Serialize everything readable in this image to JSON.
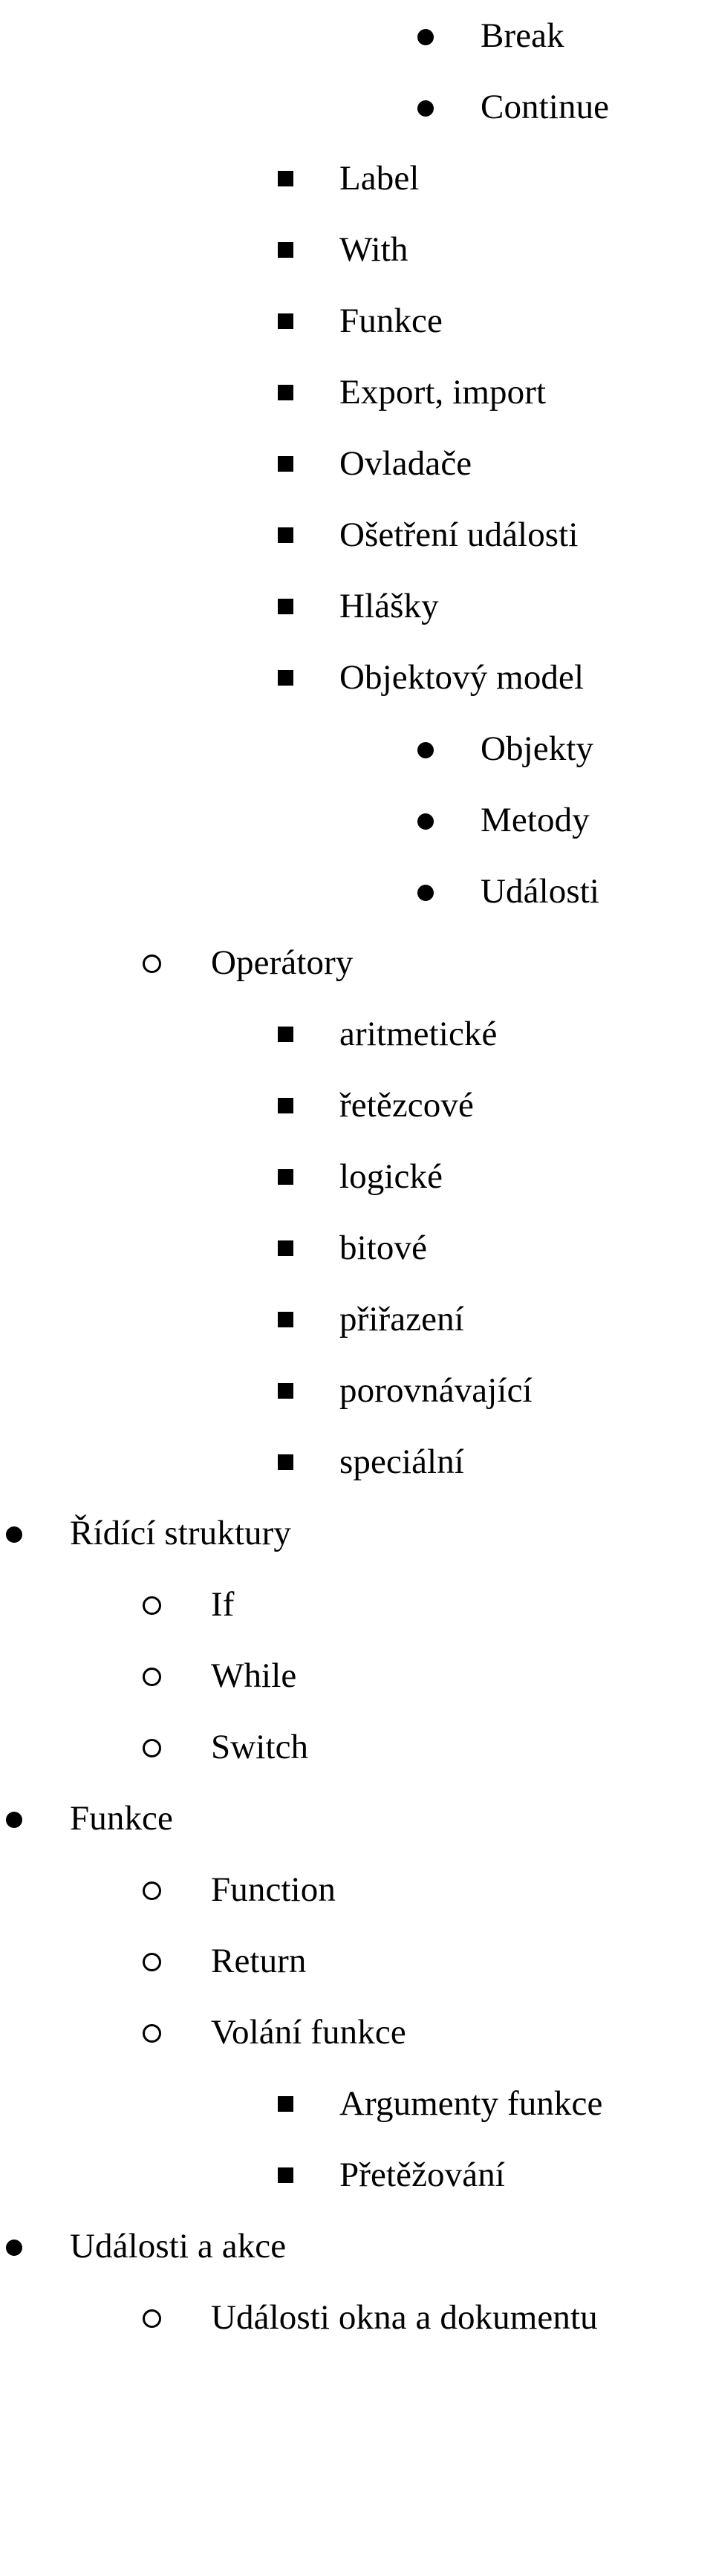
{
  "document": {
    "type": "outline-list",
    "language": "cs",
    "bullet_glyphs": {
      "level1": "filled-disc",
      "level2": "hollow-circle",
      "level3": "filled-square",
      "level4": "filled-disc"
    },
    "items": [
      {
        "level": 4,
        "marker": "disc",
        "text": "Break"
      },
      {
        "level": 4,
        "marker": "disc",
        "text": "Continue"
      },
      {
        "level": 3,
        "marker": "square",
        "text": "Label"
      },
      {
        "level": 3,
        "marker": "square",
        "text": "With"
      },
      {
        "level": 3,
        "marker": "square",
        "text": "Funkce"
      },
      {
        "level": 3,
        "marker": "square",
        "text": "Export, import"
      },
      {
        "level": 3,
        "marker": "square",
        "text": "Ovladače"
      },
      {
        "level": 3,
        "marker": "square",
        "text": "Ošetření události"
      },
      {
        "level": 3,
        "marker": "square",
        "text": "Hlášky"
      },
      {
        "level": 3,
        "marker": "square",
        "text": "Objektový model"
      },
      {
        "level": 4,
        "marker": "disc",
        "text": "Objekty"
      },
      {
        "level": 4,
        "marker": "disc",
        "text": "Metody"
      },
      {
        "level": 4,
        "marker": "disc",
        "text": "Události"
      },
      {
        "level": 2,
        "marker": "circle",
        "text": "Operátory"
      },
      {
        "level": 3,
        "marker": "square",
        "text": "aritmetické"
      },
      {
        "level": 3,
        "marker": "square",
        "text": "řetězcové"
      },
      {
        "level": 3,
        "marker": "square",
        "text": "logické"
      },
      {
        "level": 3,
        "marker": "square",
        "text": "bitové"
      },
      {
        "level": 3,
        "marker": "square",
        "text": "přiřazení"
      },
      {
        "level": 3,
        "marker": "square",
        "text": "porovnávající"
      },
      {
        "level": 3,
        "marker": "square",
        "text": "speciální"
      },
      {
        "level": 1,
        "marker": "disc",
        "text": "Řídící struktury"
      },
      {
        "level": 2,
        "marker": "circle",
        "text": "If"
      },
      {
        "level": 2,
        "marker": "circle",
        "text": "While"
      },
      {
        "level": 2,
        "marker": "circle",
        "text": "Switch"
      },
      {
        "level": 1,
        "marker": "disc",
        "text": "Funkce"
      },
      {
        "level": 2,
        "marker": "circle",
        "text": "Function"
      },
      {
        "level": 2,
        "marker": "circle",
        "text": "Return"
      },
      {
        "level": 2,
        "marker": "circle",
        "text": "Volání funkce"
      },
      {
        "level": 3,
        "marker": "square",
        "text": "Argumenty funkce"
      },
      {
        "level": 3,
        "marker": "square",
        "text": "Přetěžování"
      },
      {
        "level": 1,
        "marker": "disc",
        "text": "Události a akce"
      },
      {
        "level": 2,
        "marker": "circle",
        "text": "Události okna a dokumentu"
      }
    ]
  }
}
